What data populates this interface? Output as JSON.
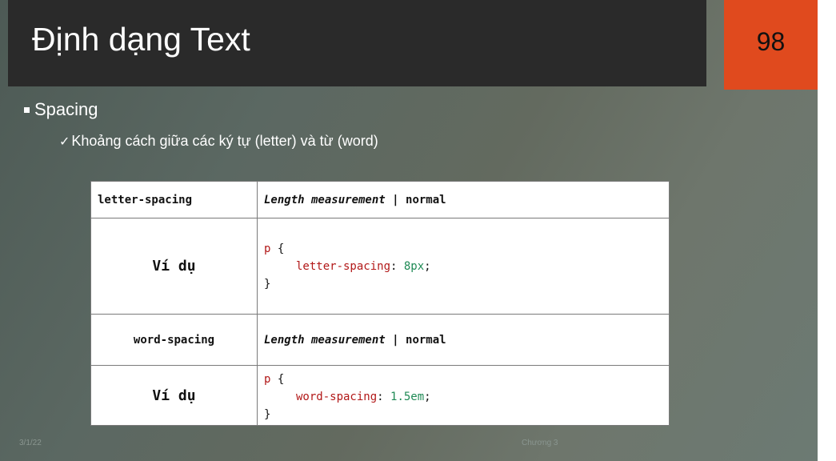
{
  "slide": {
    "title": "Định dạng Text",
    "page_number": "98",
    "bullet": "Spacing",
    "sub_bullet_mark": "✓",
    "sub_bullet": "Khoảng cách giữa các ký tự (letter) và từ (word)",
    "footer_date": "3/1/22",
    "footer_chapter": "Chương 3"
  },
  "table": {
    "rows": [
      {
        "property": "letter-spacing",
        "value_italic": "Length measurement",
        "value_sep": " | ",
        "value_normal": "normal"
      },
      {
        "example_label": "Ví dụ",
        "code_selector": "p",
        "code_open": " {",
        "code_prop": "letter-spacing",
        "code_colon": ": ",
        "code_value": "8px",
        "code_semicolon": ";",
        "code_close": "}"
      },
      {
        "property": "word-spacing",
        "value_italic": "Length measurement",
        "value_sep": " | ",
        "value_normal": "normal"
      },
      {
        "example_label": "Ví dụ",
        "code_selector": "p",
        "code_open": " {",
        "code_prop": "word-spacing",
        "code_colon": ": ",
        "code_value": "1.5em",
        "code_semicolon": ";",
        "code_close": "}"
      }
    ]
  },
  "colors": {
    "title_bar": "#2a2a2a",
    "page_box": "#e04a1e",
    "code_keyword": "#b21818",
    "code_number": "#1f8a55"
  }
}
